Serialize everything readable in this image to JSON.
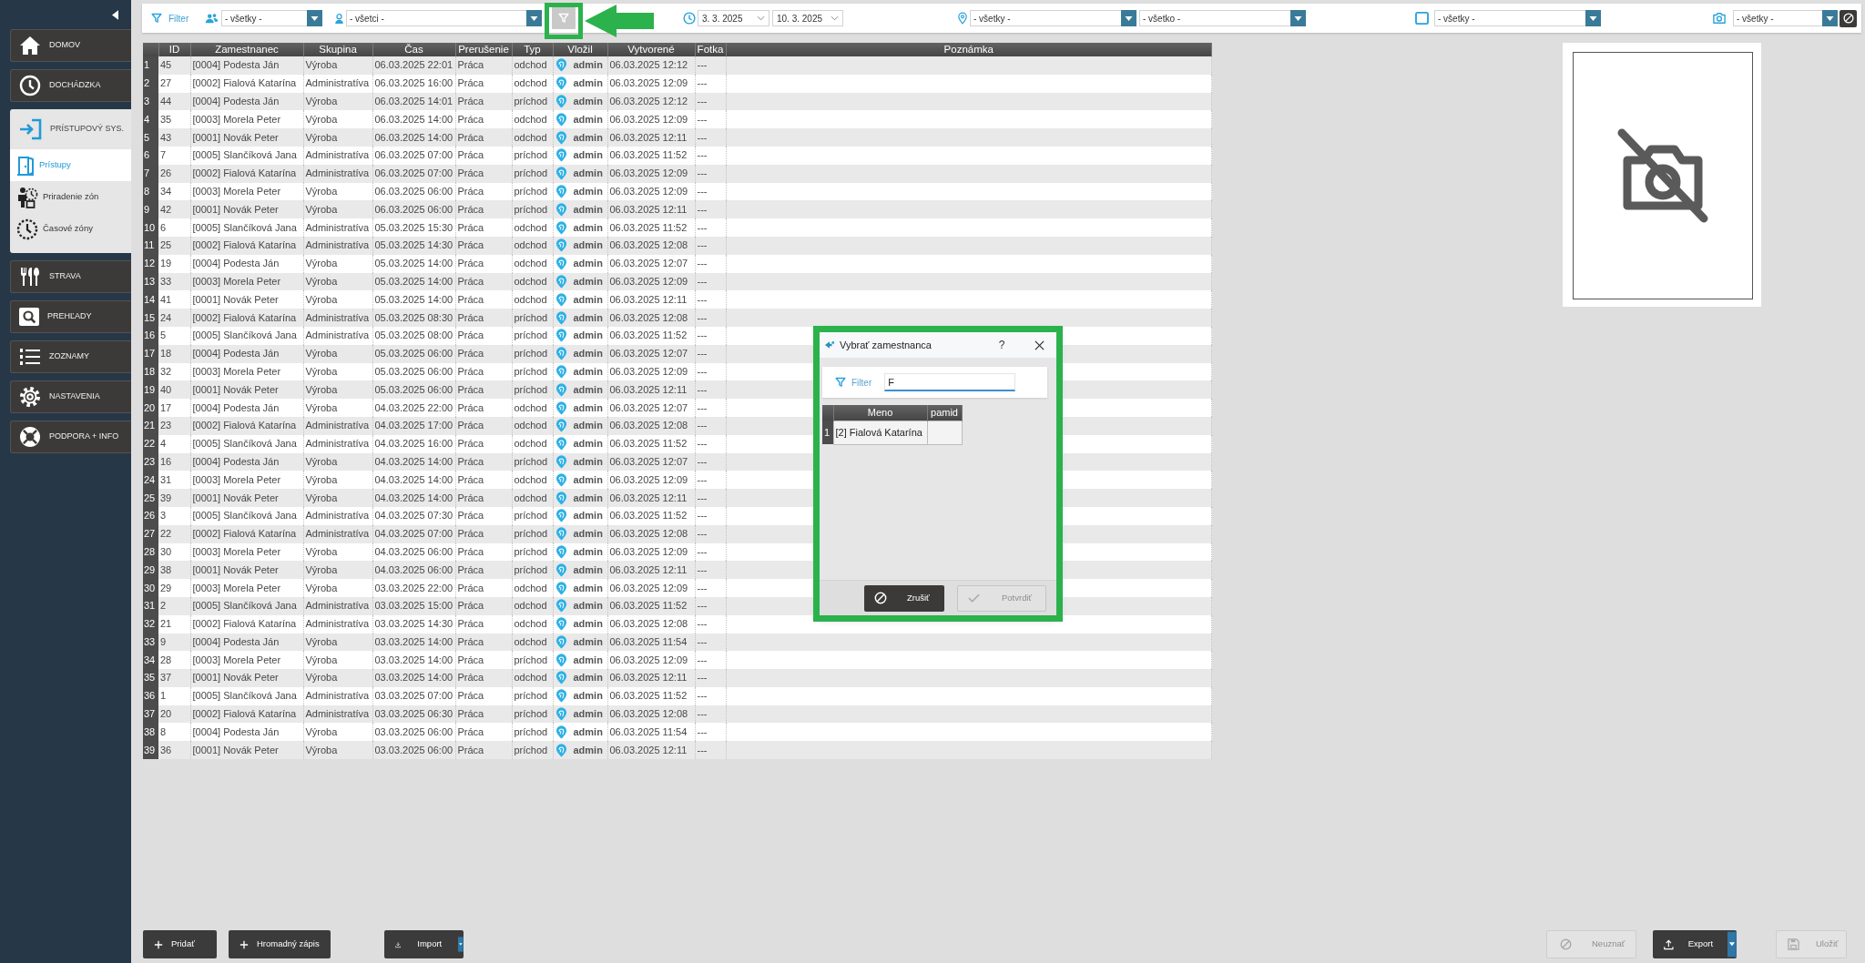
{
  "sidebar": {
    "items": [
      {
        "label": "DOMOV",
        "expanded": false
      },
      {
        "label": "DOCHÁDZKA",
        "expanded": false
      },
      {
        "label": "PRÍSTUPOVÝ SYS.",
        "expanded": true,
        "children": [
          {
            "label": "Prístupy",
            "selected": true
          },
          {
            "label": "Priradenie zón",
            "selected": false
          },
          {
            "label": "Časové zóny",
            "selected": false
          }
        ]
      },
      {
        "label": "STRAVA",
        "expanded": false
      },
      {
        "label": "PREHĽADY",
        "expanded": false
      },
      {
        "label": "ZOZNAMY",
        "expanded": false
      },
      {
        "label": "NASTAVENIA",
        "expanded": false
      },
      {
        "label": "PODPORA + INFO",
        "expanded": false
      }
    ]
  },
  "filter_bar": {
    "label": "Filter",
    "group_select": "- všetky -",
    "employee_select": "- všetci -",
    "filter_button": {
      "disabled": true
    },
    "date_from": "3. 3. 2025",
    "date_to": "10. 3. 2025",
    "location_select": "- všetky -",
    "select_6": "- všetko -",
    "select_7": "- všetky -",
    "photo_select": "- všetky -"
  },
  "table": {
    "columns": [
      "ID",
      "Zamestnanec",
      "Skupina",
      "Čas",
      "Prerušenie",
      "Typ",
      "Vložil",
      "Vytvorené",
      "Fotka",
      "Poznámka"
    ],
    "rows": [
      {
        "row": "1",
        "id": "45",
        "employee": "[0004] Podesta Ján",
        "group": "Výroba",
        "time": "06.03.2025 22:01",
        "interruption": "Práca",
        "type": "odchod",
        "inserted_by": "admin",
        "created": "06.03.2025 12:12",
        "photo": "---"
      },
      {
        "row": "2",
        "id": "27",
        "employee": "[0002] Fialová Katarína",
        "group": "Administratíva",
        "time": "06.03.2025 16:00",
        "interruption": "Práca",
        "type": "odchod",
        "inserted_by": "admin",
        "created": "06.03.2025 12:09",
        "photo": "---"
      },
      {
        "row": "3",
        "id": "44",
        "employee": "[0004] Podesta Ján",
        "group": "Výroba",
        "time": "06.03.2025 14:01",
        "interruption": "Práca",
        "type": "príchod",
        "inserted_by": "admin",
        "created": "06.03.2025 12:12",
        "photo": "---"
      },
      {
        "row": "4",
        "id": "35",
        "employee": "[0003] Morela Peter",
        "group": "Výroba",
        "time": "06.03.2025 14:00",
        "interruption": "Práca",
        "type": "odchod",
        "inserted_by": "admin",
        "created": "06.03.2025 12:09",
        "photo": "---"
      },
      {
        "row": "5",
        "id": "43",
        "employee": "[0001] Novák Peter",
        "group": "Výroba",
        "time": "06.03.2025 14:00",
        "interruption": "Práca",
        "type": "odchod",
        "inserted_by": "admin",
        "created": "06.03.2025 12:11",
        "photo": "---"
      },
      {
        "row": "6",
        "id": "7",
        "employee": "[0005] Slančíková Jana",
        "group": "Administratíva",
        "time": "06.03.2025 07:00",
        "interruption": "Práca",
        "type": "príchod",
        "inserted_by": "admin",
        "created": "06.03.2025 11:52",
        "photo": "---"
      },
      {
        "row": "7",
        "id": "26",
        "employee": "[0002] Fialová Katarína",
        "group": "Administratíva",
        "time": "06.03.2025 07:00",
        "interruption": "Práca",
        "type": "príchod",
        "inserted_by": "admin",
        "created": "06.03.2025 12:09",
        "photo": "---"
      },
      {
        "row": "8",
        "id": "34",
        "employee": "[0003] Morela Peter",
        "group": "Výroba",
        "time": "06.03.2025 06:00",
        "interruption": "Práca",
        "type": "príchod",
        "inserted_by": "admin",
        "created": "06.03.2025 12:09",
        "photo": "---"
      },
      {
        "row": "9",
        "id": "42",
        "employee": "[0001] Novák Peter",
        "group": "Výroba",
        "time": "06.03.2025 06:00",
        "interruption": "Práca",
        "type": "príchod",
        "inserted_by": "admin",
        "created": "06.03.2025 12:11",
        "photo": "---"
      },
      {
        "row": "10",
        "id": "6",
        "employee": "[0005] Slančíková Jana",
        "group": "Administratíva",
        "time": "05.03.2025 15:30",
        "interruption": "Práca",
        "type": "odchod",
        "inserted_by": "admin",
        "created": "06.03.2025 11:52",
        "photo": "---"
      },
      {
        "row": "11",
        "id": "25",
        "employee": "[0002] Fialová Katarína",
        "group": "Administratíva",
        "time": "05.03.2025 14:30",
        "interruption": "Práca",
        "type": "odchod",
        "inserted_by": "admin",
        "created": "06.03.2025 12:08",
        "photo": "---"
      },
      {
        "row": "12",
        "id": "19",
        "employee": "[0004] Podesta Ján",
        "group": "Výroba",
        "time": "05.03.2025 14:00",
        "interruption": "Práca",
        "type": "odchod",
        "inserted_by": "admin",
        "created": "06.03.2025 12:07",
        "photo": "---"
      },
      {
        "row": "13",
        "id": "33",
        "employee": "[0003] Morela Peter",
        "group": "Výroba",
        "time": "05.03.2025 14:00",
        "interruption": "Práca",
        "type": "odchod",
        "inserted_by": "admin",
        "created": "06.03.2025 12:09",
        "photo": "---"
      },
      {
        "row": "14",
        "id": "41",
        "employee": "[0001] Novák Peter",
        "group": "Výroba",
        "time": "05.03.2025 14:00",
        "interruption": "Práca",
        "type": "odchod",
        "inserted_by": "admin",
        "created": "06.03.2025 12:11",
        "photo": "---"
      },
      {
        "row": "15",
        "id": "24",
        "employee": "[0002] Fialová Katarína",
        "group": "Administratíva",
        "time": "05.03.2025 08:30",
        "interruption": "Práca",
        "type": "príchod",
        "inserted_by": "admin",
        "created": "06.03.2025 12:08",
        "photo": "---"
      },
      {
        "row": "16",
        "id": "5",
        "employee": "[0005] Slančíková Jana",
        "group": "Administratíva",
        "time": "05.03.2025 08:00",
        "interruption": "Práca",
        "type": "príchod",
        "inserted_by": "admin",
        "created": "06.03.2025 11:52",
        "photo": "---"
      },
      {
        "row": "17",
        "id": "18",
        "employee": "[0004] Podesta Ján",
        "group": "Výroba",
        "time": "05.03.2025 06:00",
        "interruption": "Práca",
        "type": "príchod",
        "inserted_by": "admin",
        "created": "06.03.2025 12:07",
        "photo": "---"
      },
      {
        "row": "18",
        "id": "32",
        "employee": "[0003] Morela Peter",
        "group": "Výroba",
        "time": "05.03.2025 06:00",
        "interruption": "Práca",
        "type": "príchod",
        "inserted_by": "admin",
        "created": "06.03.2025 12:09",
        "photo": "---"
      },
      {
        "row": "19",
        "id": "40",
        "employee": "[0001] Novák Peter",
        "group": "Výroba",
        "time": "05.03.2025 06:00",
        "interruption": "Práca",
        "type": "príchod",
        "inserted_by": "admin",
        "created": "06.03.2025 12:11",
        "photo": "---"
      },
      {
        "row": "20",
        "id": "17",
        "employee": "[0004] Podesta Ján",
        "group": "Výroba",
        "time": "04.03.2025 22:00",
        "interruption": "Práca",
        "type": "odchod",
        "inserted_by": "admin",
        "created": "06.03.2025 12:07",
        "photo": "---"
      },
      {
        "row": "21",
        "id": "23",
        "employee": "[0002] Fialová Katarína",
        "group": "Administratíva",
        "time": "04.03.2025 17:00",
        "interruption": "Práca",
        "type": "odchod",
        "inserted_by": "admin",
        "created": "06.03.2025 12:08",
        "photo": "---"
      },
      {
        "row": "22",
        "id": "4",
        "employee": "[0005] Slančíková Jana",
        "group": "Administratíva",
        "time": "04.03.2025 16:00",
        "interruption": "Práca",
        "type": "odchod",
        "inserted_by": "admin",
        "created": "06.03.2025 11:52",
        "photo": "---"
      },
      {
        "row": "23",
        "id": "16",
        "employee": "[0004] Podesta Ján",
        "group": "Výroba",
        "time": "04.03.2025 14:00",
        "interruption": "Práca",
        "type": "príchod",
        "inserted_by": "admin",
        "created": "06.03.2025 12:07",
        "photo": "---"
      },
      {
        "row": "24",
        "id": "31",
        "employee": "[0003] Morela Peter",
        "group": "Výroba",
        "time": "04.03.2025 14:00",
        "interruption": "Práca",
        "type": "odchod",
        "inserted_by": "admin",
        "created": "06.03.2025 12:09",
        "photo": "---"
      },
      {
        "row": "25",
        "id": "39",
        "employee": "[0001] Novák Peter",
        "group": "Výroba",
        "time": "04.03.2025 14:00",
        "interruption": "Práca",
        "type": "odchod",
        "inserted_by": "admin",
        "created": "06.03.2025 12:11",
        "photo": "---"
      },
      {
        "row": "26",
        "id": "3",
        "employee": "[0005] Slančíková Jana",
        "group": "Administratíva",
        "time": "04.03.2025 07:30",
        "interruption": "Práca",
        "type": "príchod",
        "inserted_by": "admin",
        "created": "06.03.2025 11:52",
        "photo": "---"
      },
      {
        "row": "27",
        "id": "22",
        "employee": "[0002] Fialová Katarína",
        "group": "Administratíva",
        "time": "04.03.2025 07:00",
        "interruption": "Práca",
        "type": "príchod",
        "inserted_by": "admin",
        "created": "06.03.2025 12:08",
        "photo": "---"
      },
      {
        "row": "28",
        "id": "30",
        "employee": "[0003] Morela Peter",
        "group": "Výroba",
        "time": "04.03.2025 06:00",
        "interruption": "Práca",
        "type": "príchod",
        "inserted_by": "admin",
        "created": "06.03.2025 12:09",
        "photo": "---"
      },
      {
        "row": "29",
        "id": "38",
        "employee": "[0001] Novák Peter",
        "group": "Výroba",
        "time": "04.03.2025 06:00",
        "interruption": "Práca",
        "type": "príchod",
        "inserted_by": "admin",
        "created": "06.03.2025 12:11",
        "photo": "---"
      },
      {
        "row": "30",
        "id": "29",
        "employee": "[0003] Morela Peter",
        "group": "Výroba",
        "time": "03.03.2025 22:00",
        "interruption": "Práca",
        "type": "odchod",
        "inserted_by": "admin",
        "created": "06.03.2025 12:09",
        "photo": "---"
      },
      {
        "row": "31",
        "id": "2",
        "employee": "[0005] Slančíková Jana",
        "group": "Administratíva",
        "time": "03.03.2025 15:00",
        "interruption": "Práca",
        "type": "odchod",
        "inserted_by": "admin",
        "created": "06.03.2025 11:52",
        "photo": "---"
      },
      {
        "row": "32",
        "id": "21",
        "employee": "[0002] Fialová Katarína",
        "group": "Administratíva",
        "time": "03.03.2025 14:30",
        "interruption": "Práca",
        "type": "odchod",
        "inserted_by": "admin",
        "created": "06.03.2025 12:08",
        "photo": "---"
      },
      {
        "row": "33",
        "id": "9",
        "employee": "[0004] Podesta Ján",
        "group": "Výroba",
        "time": "03.03.2025 14:00",
        "interruption": "Práca",
        "type": "odchod",
        "inserted_by": "admin",
        "created": "06.03.2025 11:54",
        "photo": "---"
      },
      {
        "row": "34",
        "id": "28",
        "employee": "[0003] Morela Peter",
        "group": "Výroba",
        "time": "03.03.2025 14:00",
        "interruption": "Práca",
        "type": "príchod",
        "inserted_by": "admin",
        "created": "06.03.2025 12:09",
        "photo": "---"
      },
      {
        "row": "35",
        "id": "37",
        "employee": "[0001] Novák Peter",
        "group": "Výroba",
        "time": "03.03.2025 14:00",
        "interruption": "Práca",
        "type": "odchod",
        "inserted_by": "admin",
        "created": "06.03.2025 12:11",
        "photo": "---"
      },
      {
        "row": "36",
        "id": "1",
        "employee": "[0005] Slančíková Jana",
        "group": "Administratíva",
        "time": "03.03.2025 07:00",
        "interruption": "Práca",
        "type": "príchod",
        "inserted_by": "admin",
        "created": "06.03.2025 11:52",
        "photo": "---"
      },
      {
        "row": "37",
        "id": "20",
        "employee": "[0002] Fialová Katarína",
        "group": "Administratíva",
        "time": "03.03.2025 06:30",
        "interruption": "Práca",
        "type": "príchod",
        "inserted_by": "admin",
        "created": "06.03.2025 12:08",
        "photo": "---"
      },
      {
        "row": "38",
        "id": "8",
        "employee": "[0004] Podesta Ján",
        "group": "Výroba",
        "time": "03.03.2025 06:00",
        "interruption": "Práca",
        "type": "príchod",
        "inserted_by": "admin",
        "created": "06.03.2025 11:54",
        "photo": "---"
      },
      {
        "row": "39",
        "id": "36",
        "employee": "[0001] Novák Peter",
        "group": "Výroba",
        "time": "03.03.2025 06:00",
        "interruption": "Práca",
        "type": "príchod",
        "inserted_by": "admin",
        "created": "06.03.2025 12:11",
        "photo": "---"
      }
    ]
  },
  "dialog": {
    "title": "Vybrať zamestnanca",
    "help": "?",
    "filter_label": "Filter",
    "filter_value": "F",
    "grid": {
      "columns": [
        "Meno",
        "pamid"
      ],
      "rows": [
        {
          "row": "1",
          "name": "[2] Fialová Katarína"
        }
      ]
    },
    "buttons": [
      {
        "label": "Zrušiť",
        "disabled": false
      },
      {
        "label": "Potvrdiť",
        "disabled": true
      }
    ]
  },
  "bottom_bar": {
    "left": [
      {
        "label": "Pridať",
        "kind": "button",
        "disabled": false
      },
      {
        "label": "Hromadný zápis",
        "kind": "button",
        "disabled": false
      },
      {
        "label": "Import",
        "kind": "dropdown",
        "disabled": false
      }
    ],
    "right": [
      {
        "label": "Neuznať",
        "kind": "button",
        "disabled": true
      },
      {
        "label": "Export",
        "kind": "dropdown",
        "disabled": false
      },
      {
        "label": "Uložiť",
        "kind": "button",
        "disabled": true
      }
    ]
  }
}
